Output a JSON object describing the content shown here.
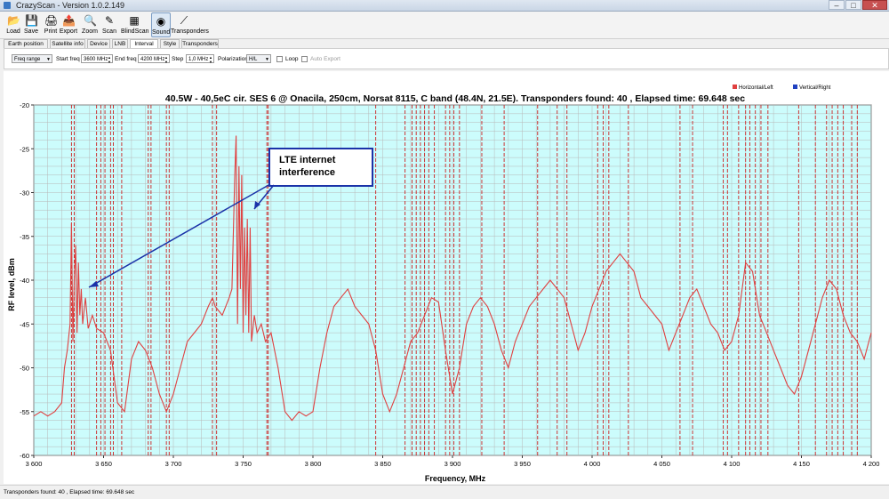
{
  "window": {
    "title": "CrazyScan - Version 1.0.2.149",
    "minimize": "–",
    "maximize": "□",
    "close": "✕"
  },
  "toolbar": [
    {
      "label": "Load",
      "icon": "folder-icon",
      "glyph": "📂"
    },
    {
      "label": "Save",
      "icon": "save-icon",
      "glyph": "💾"
    },
    {
      "label": "Print",
      "icon": "print-icon",
      "glyph": "🖨"
    },
    {
      "label": "Export",
      "icon": "export-icon",
      "glyph": "📤"
    },
    {
      "label": "Zoom",
      "icon": "zoom-icon",
      "glyph": "🔍"
    },
    {
      "label": "Scan",
      "icon": "scan-icon",
      "glyph": "✎"
    },
    {
      "label": "BlindScan",
      "icon": "blindscan-icon",
      "glyph": "▦"
    },
    {
      "label": "Sound",
      "icon": "sound-icon",
      "glyph": "◉"
    },
    {
      "label": "Transponders",
      "icon": "transponders-icon",
      "glyph": "⟋"
    }
  ],
  "tabs": [
    "Earth position",
    "Satellite info",
    "Device",
    "LNB",
    "Interval",
    "Style",
    "Transponders"
  ],
  "active_tab": "Interval",
  "options": {
    "mode": "Freq range",
    "start_label": "Start freq",
    "start_value": "3600 MHz",
    "end_label": "End freq",
    "end_value": "4200 MHz",
    "step_label": "Step",
    "step_value": "1,0 MHz",
    "pol_label": "Polarization",
    "pol_value": "H/L",
    "loop_label": "Loop",
    "autoexport_label": "Auto Export"
  },
  "chart_data": {
    "type": "line",
    "title": "40.5W - 40,5eC cir. SES 6 @ Onacila, 250cm, Norsat 8115, C band (48.4N, 21.5E). Transponders found: 40 , Elapsed time: 69.648 sec",
    "xlabel": "Frequency, MHz",
    "ylabel": "RF level, dBm",
    "xlim": [
      3600,
      4200
    ],
    "ylim": [
      -60,
      -20
    ],
    "xticks": [
      3600,
      3650,
      3700,
      3750,
      3800,
      3850,
      3900,
      3950,
      4000,
      4050,
      4100,
      4150,
      4200
    ],
    "xtick_labels": [
      "3 600",
      "3 650",
      "3 700",
      "3 750",
      "3 800",
      "3 850",
      "3 900",
      "3 950",
      "4 000",
      "4 050",
      "4 100",
      "4 150",
      "4 200"
    ],
    "yticks": [
      -20,
      -25,
      -30,
      -35,
      -40,
      -45,
      -50,
      -55,
      -60
    ],
    "grid": true,
    "legend_position": "top-right",
    "background": "#ccfcfc",
    "series": [
      {
        "name": "Horizontal/Left",
        "color": "#e04040",
        "x": [
          3600,
          3605,
          3610,
          3615,
          3620,
          3622,
          3624,
          3626,
          3627,
          3628,
          3629,
          3630,
          3631,
          3632,
          3633,
          3634,
          3635,
          3637,
          3639,
          3642,
          3645,
          3650,
          3655,
          3660,
          3665,
          3670,
          3675,
          3680,
          3685,
          3690,
          3695,
          3700,
          3705,
          3710,
          3715,
          3720,
          3725,
          3728,
          3730,
          3735,
          3740,
          3742,
          3744,
          3745,
          3746,
          3747,
          3748,
          3749,
          3750,
          3751,
          3752,
          3753,
          3754,
          3755,
          3756,
          3758,
          3760,
          3763,
          3766,
          3770,
          3775,
          3780,
          3785,
          3790,
          3795,
          3800,
          3805,
          3810,
          3815,
          3820,
          3825,
          3830,
          3835,
          3840,
          3845,
          3850,
          3855,
          3860,
          3865,
          3870,
          3875,
          3880,
          3885,
          3890,
          3895,
          3900,
          3905,
          3910,
          3915,
          3920,
          3925,
          3930,
          3935,
          3940,
          3945,
          3950,
          3955,
          3960,
          3965,
          3970,
          3975,
          3980,
          3985,
          3990,
          3995,
          4000,
          4005,
          4010,
          4015,
          4020,
          4025,
          4030,
          4035,
          4040,
          4045,
          4050,
          4055,
          4060,
          4065,
          4070,
          4075,
          4080,
          4085,
          4090,
          4095,
          4100,
          4105,
          4110,
          4115,
          4120,
          4125,
          4130,
          4135,
          4140,
          4145,
          4150,
          4155,
          4160,
          4165,
          4170,
          4175,
          4180,
          4185,
          4190,
          4195,
          4200
        ],
        "y": [
          -55.5,
          -55,
          -55.5,
          -55,
          -54,
          -50,
          -48,
          -45,
          -33.5,
          -47,
          -40,
          -36,
          -46,
          -38,
          -44,
          -41,
          -45,
          -42,
          -45.5,
          -44,
          -45.5,
          -46,
          -48,
          -54,
          -55,
          -49,
          -47,
          -48,
          -50,
          -53,
          -55,
          -53,
          -50,
          -47,
          -46,
          -45,
          -43,
          -42,
          -43,
          -44,
          -42,
          -41,
          -28,
          -23.5,
          -45,
          -27,
          -41,
          -28,
          -46,
          -34,
          -44,
          -33,
          -46,
          -34,
          -47,
          -44,
          -46,
          -45,
          -47,
          -46,
          -50,
          -55,
          -56,
          -55,
          -55.5,
          -55,
          -50,
          -46,
          -43,
          -42,
          -41,
          -43,
          -44,
          -45,
          -48,
          -53,
          -55,
          -53,
          -50,
          -47,
          -46,
          -44,
          -42,
          -42.5,
          -48,
          -53,
          -50,
          -45,
          -43,
          -42,
          -43,
          -45,
          -48,
          -50,
          -47,
          -45,
          -43,
          -42,
          -41,
          -40,
          -41,
          -42,
          -45,
          -48,
          -46,
          -43,
          -41,
          -39,
          -38,
          -37,
          -38,
          -39,
          -42,
          -43,
          -44,
          -45,
          -48,
          -46,
          -44,
          -42,
          -41,
          -43,
          -45,
          -46,
          -48,
          -47,
          -44,
          -38,
          -39,
          -44,
          -46,
          -48,
          -50,
          -52,
          -53,
          -51,
          -48,
          -45,
          -42,
          -40,
          -41,
          -44,
          -46,
          -47,
          -49,
          -46
        ]
      },
      {
        "name": "Vertical/Right",
        "color": "#2040c0",
        "x": [],
        "y": []
      }
    ],
    "transponder_markers": [
      3627,
      3629,
      3645,
      3648,
      3651,
      3655,
      3657,
      3663,
      3682,
      3684,
      3695,
      3697,
      3728,
      3731,
      3767,
      3768,
      3845,
      3866,
      3871,
      3874,
      3877,
      3880,
      3883,
      3887,
      3895,
      3898,
      3901,
      3905,
      3921,
      3937,
      3961,
      3975,
      3982,
      4004,
      4008,
      4012,
      4026,
      4063,
      4072,
      4094,
      4097,
      4105,
      4110,
      4113,
      4117,
      4121,
      4126,
      4148,
      4160,
      4168,
      4172,
      4176,
      4180,
      4186,
      4190
    ]
  },
  "annotation": {
    "text_line1": "LTE internet",
    "text_line2": "interference"
  },
  "status": "Transponders found: 40 , Elapsed time: 69.648 sec"
}
